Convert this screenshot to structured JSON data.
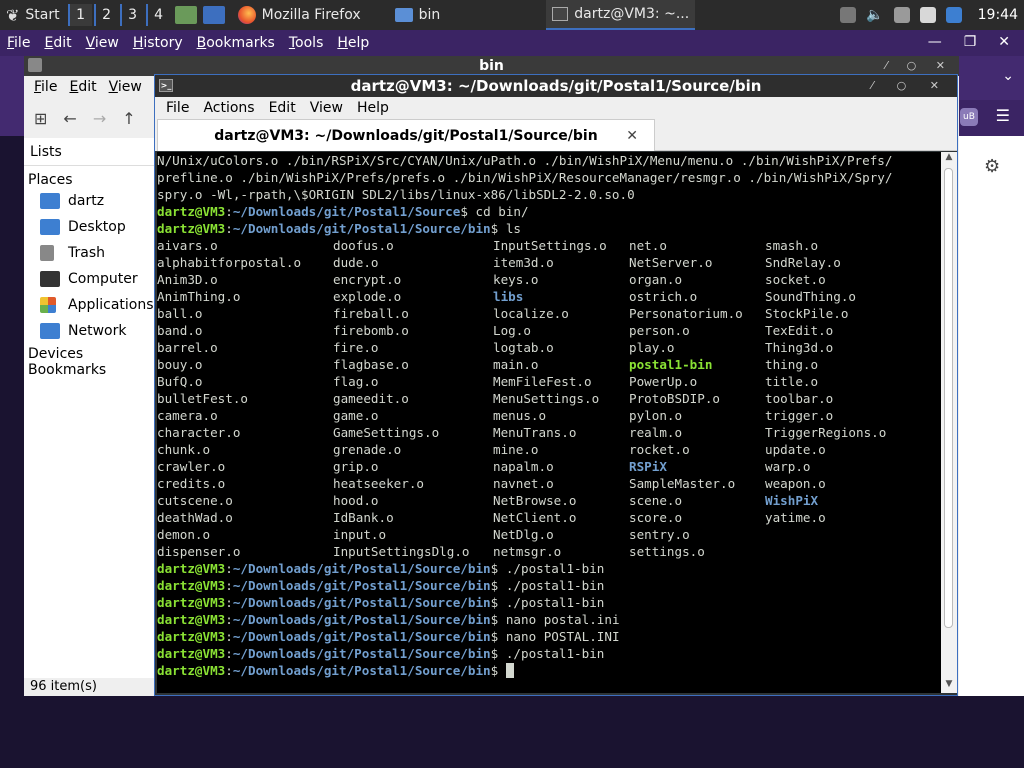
{
  "taskbar": {
    "start_label": "Start",
    "workspaces": [
      "1",
      "2",
      "3",
      "4"
    ],
    "tasks": [
      {
        "label": "Mozilla Firefox",
        "icon": "firefox-icon"
      },
      {
        "label": "bin",
        "icon": "folder-icon"
      },
      {
        "label": "dartz@VM3: ~...",
        "icon": "terminal-icon"
      }
    ],
    "clock": "19:44"
  },
  "firefox": {
    "menu": [
      {
        "label": "File",
        "ul": "F",
        "rest": "ile"
      },
      {
        "label": "Edit",
        "ul": "E",
        "rest": "dit"
      },
      {
        "label": "View",
        "ul": "V",
        "rest": "iew"
      },
      {
        "label": "History",
        "ul": "H",
        "rest": "istory"
      },
      {
        "label": "Bookmarks",
        "ul": "B",
        "rest": "ookmarks"
      },
      {
        "label": "Tools",
        "ul": "T",
        "rest": "ools"
      },
      {
        "label": "Help",
        "ul": "H",
        "rest": "elp"
      }
    ],
    "accent": "#432a70"
  },
  "file_manager": {
    "title": "bin",
    "menu": [
      {
        "ul": "F",
        "rest": "ile"
      },
      {
        "ul": "E",
        "rest": "dit"
      },
      {
        "ul": "V",
        "rest": "iew"
      }
    ],
    "side_header": "Lists",
    "places_label": "Places",
    "places": [
      {
        "label": "dartz",
        "color": "#3d7fd1"
      },
      {
        "label": "Desktop",
        "color": "#3d7fd1"
      },
      {
        "label": "Trash",
        "color": "#888888"
      },
      {
        "label": "Computer",
        "color": "#333333"
      },
      {
        "label": "Applications",
        "color": "#e05a2b"
      },
      {
        "label": "Network",
        "color": "#3d7fd1"
      }
    ],
    "devices_label": "Devices",
    "bookmarks_label": "Bookmarks",
    "status": "96 item(s)"
  },
  "terminal": {
    "title": "dartz@VM3: ~/Downloads/git/Postal1/Source/bin",
    "menu": [
      "File",
      "Actions",
      "Edit",
      "View",
      "Help"
    ],
    "tab_label": "dartz@VM3: ~/Downloads/git/Postal1/Source/bin",
    "output_lines": [
      "N/Unix/uColors.o ./bin/RSPiX/Src/CYAN/Unix/uPath.o ./bin/WishPiX/Menu/menu.o ./bin/WishPiX/Prefs/",
      "prefline.o ./bin/WishPiX/Prefs/prefs.o ./bin/WishPiX/ResourceManager/resmgr.o ./bin/WishPiX/Spry/",
      "spry.o -Wl,-rpath,\\$ORIGIN SDL2/libs/linux-x86/libSDL2-2.0.so.0"
    ],
    "prompt_user": "dartz@VM3",
    "prompt_path_source": "~/Downloads/git/Postal1/Source",
    "prompt_path_bin": "~/Downloads/git/Postal1/Source/bin",
    "cmd_cd": " cd bin/",
    "cmd_ls": " ls",
    "ls_rows": [
      [
        "aivars.o",
        "doofus.o",
        "InputSettings.o",
        "net.o",
        "smash.o"
      ],
      [
        "alphabitforpostal.o",
        "dude.o",
        "item3d.o",
        "NetServer.o",
        "SndRelay.o"
      ],
      [
        "Anim3D.o",
        "encrypt.o",
        "keys.o",
        "organ.o",
        "socket.o"
      ],
      [
        "AnimThing.o",
        "explode.o",
        "libs",
        "ostrich.o",
        "SoundThing.o"
      ],
      [
        "ball.o",
        "fireball.o",
        "localize.o",
        "Personatorium.o",
        "StockPile.o"
      ],
      [
        "band.o",
        "firebomb.o",
        "Log.o",
        "person.o",
        "TexEdit.o"
      ],
      [
        "barrel.o",
        "fire.o",
        "logtab.o",
        "play.o",
        "Thing3d.o"
      ],
      [
        "bouy.o",
        "flagbase.o",
        "main.o",
        "postal1-bin",
        "thing.o"
      ],
      [
        "BufQ.o",
        "flag.o",
        "MemFileFest.o",
        "PowerUp.o",
        "title.o"
      ],
      [
        "bulletFest.o",
        "gameedit.o",
        "MenuSettings.o",
        "ProtoBSDIP.o",
        "toolbar.o"
      ],
      [
        "camera.o",
        "game.o",
        "menus.o",
        "pylon.o",
        "trigger.o"
      ],
      [
        "character.o",
        "GameSettings.o",
        "MenuTrans.o",
        "realm.o",
        "TriggerRegions.o"
      ],
      [
        "chunk.o",
        "grenade.o",
        "mine.o",
        "rocket.o",
        "update.o"
      ],
      [
        "crawler.o",
        "grip.o",
        "napalm.o",
        "RSPiX",
        "warp.o"
      ],
      [
        "credits.o",
        "heatseeker.o",
        "navnet.o",
        "SampleMaster.o",
        "weapon.o"
      ],
      [
        "cutscene.o",
        "hood.o",
        "NetBrowse.o",
        "scene.o",
        "WishPiX"
      ],
      [
        "deathWad.o",
        "IdBank.o",
        "NetClient.o",
        "score.o",
        "yatime.o"
      ],
      [
        "demon.o",
        "input.o",
        "NetDlg.o",
        "sentry.o",
        ""
      ],
      [
        "dispenser.o",
        "InputSettingsDlg.o",
        "netmsgr.o",
        "settings.o",
        ""
      ]
    ],
    "dirs": [
      "libs",
      "RSPiX",
      "WishPiX"
    ],
    "exes": [
      "postal1-bin"
    ],
    "after_commands": [
      " ./postal1-bin",
      " ./postal1-bin",
      " ./postal1-bin",
      " nano postal.ini",
      " nano POSTAL.INI",
      " ./postal1-bin"
    ],
    "dollar": "$"
  }
}
